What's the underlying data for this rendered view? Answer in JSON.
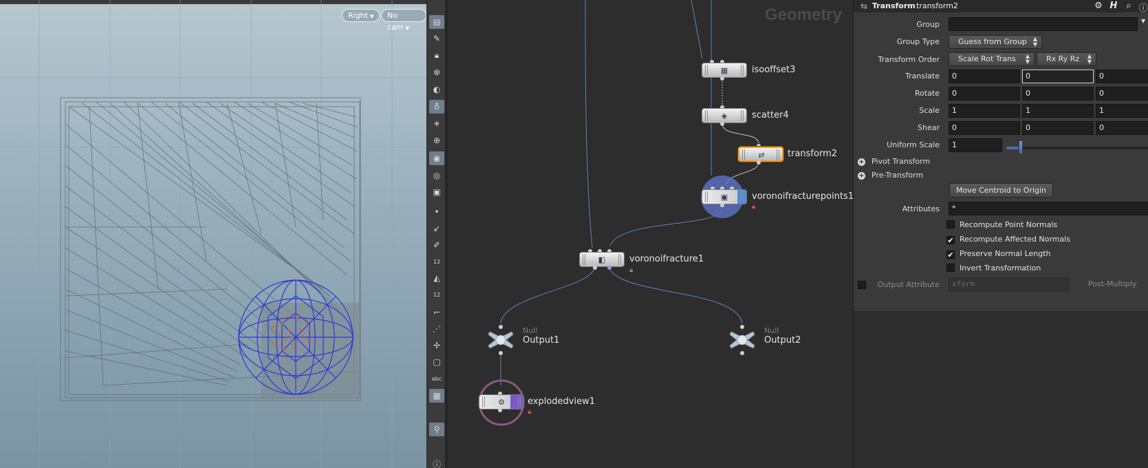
{
  "viewport": {
    "view_menu": "Right",
    "camera_menu": "No cam"
  },
  "toolbar": {
    "icons": [
      "display-options-icon",
      "paint-icon",
      "lock-icon",
      "snap-icon",
      "light-icon",
      "light-bulb-icon",
      "headlight-icon",
      "add-light-icon",
      "shaded-icon",
      "visualize-icon",
      "ghost-icon",
      "point-icon",
      "normal-icon",
      "pen-icon",
      "point-numbers-icon",
      "fill-icon",
      "prim-numbers-icon",
      "corner-icon",
      "grid-icon",
      "handles-icon",
      "frame-icon",
      "text-icon",
      "background-image-icon",
      "location-icon",
      "info-icon"
    ],
    "point_numbers_label": "12",
    "prim_numbers_label": "12",
    "text_label": "abc"
  },
  "network": {
    "context_title": "Geometry",
    "nodes": {
      "isooffset3": "isooffset3",
      "scatter4": "scatter4",
      "transform2": "transform2",
      "voronoifracturepoints1": "voronoifracturepoints1",
      "voronoifracture1": "voronoifracture1",
      "output1_type": "Null",
      "output1": "Output1",
      "output2_type": "Null",
      "output2": "Output2",
      "explodedview1": "explodedview1"
    }
  },
  "params": {
    "node_type": "Transform",
    "node_name": "transform2",
    "header_icons": [
      "gear-icon",
      "help-icon",
      "search-icon",
      "info-icon"
    ],
    "group_label": "Group",
    "group_value": "",
    "group_type_label": "Group Type",
    "group_type_value": "Guess from Group",
    "transform_order_label": "Transform Order",
    "transform_order_value": "Scale Rot Trans",
    "rotate_order_value": "Rx Ry Rz",
    "translate_label": "Translate",
    "translate": [
      "0",
      "0",
      "0"
    ],
    "rotate_label": "Rotate",
    "rotate": [
      "0",
      "0",
      "0"
    ],
    "scale_label": "Scale",
    "scale": [
      "1",
      "1",
      "1"
    ],
    "shear_label": "Shear",
    "shear": [
      "0",
      "0",
      "0"
    ],
    "uniform_scale_label": "Uniform Scale",
    "uniform_scale_value": "1",
    "uniform_scale_slider": 0.1,
    "pivot_transform_label": "Pivot Transform",
    "pre_transform_label": "Pre-Transform",
    "move_centroid_label": "Move Centroid to Origin",
    "attributes_label": "Attributes",
    "attributes_value": "*",
    "recompute_point_normals_label": "Recompute Point Normals",
    "recompute_point_normals": false,
    "recompute_affected_normals_label": "Recompute Affected Normals",
    "recompute_affected_normals": true,
    "preserve_normal_length_label": "Preserve Normal Length",
    "preserve_normal_length": true,
    "invert_transformation_label": "Invert Transformation",
    "invert_transformation": false,
    "output_attribute_label": "Output Attribute",
    "output_attribute_value": "xform",
    "output_attribute_enabled": false,
    "post_multiply_label": "Post-Multiply"
  }
}
